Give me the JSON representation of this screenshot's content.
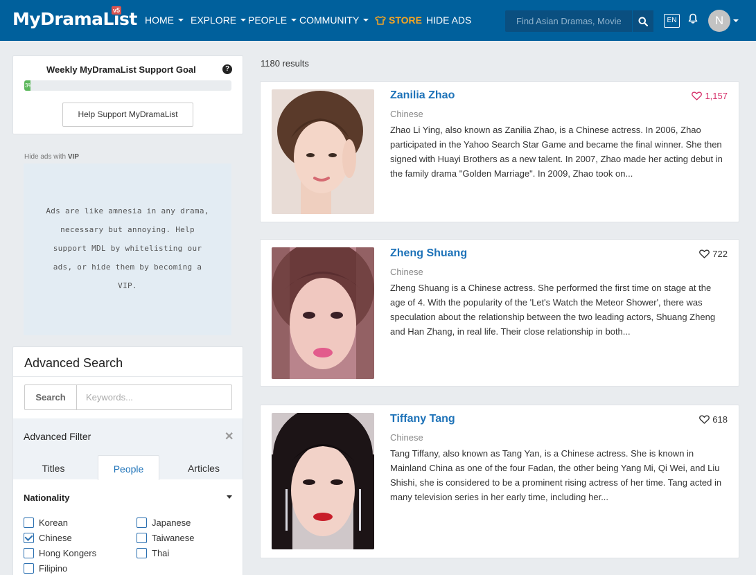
{
  "header": {
    "logo": "MyDramaList",
    "logo_badge": "v5",
    "nav": [
      {
        "label": "HOME"
      },
      {
        "label": "EXPLORE"
      },
      {
        "label": "PEOPLE"
      },
      {
        "label": "COMMUNITY"
      },
      {
        "label": "STORE"
      },
      {
        "label": "HIDE ADS"
      }
    ],
    "search_placeholder": "Find Asian Dramas, Movies",
    "lang": "EN",
    "avatar_initial": "N",
    "colors": {
      "bar": "#00609c",
      "store": "#f5a623"
    }
  },
  "support": {
    "title": "Weekly MyDramaList Support Goal",
    "progress_label": "3%",
    "progress_fraction": 0.03,
    "button": "Help Support MyDramaList"
  },
  "ads": {
    "hide_prefix": "Hide ads with",
    "hide_vip": "VIP",
    "message": "Ads are like amnesia in any drama, necessary but annoying. Help support MDL by whitelisting our ads, or hide them by becoming a VIP."
  },
  "advanced_search": {
    "title": "Advanced Search",
    "search_button": "Search",
    "keywords_placeholder": "Keywords...",
    "filter_title": "Advanced Filter",
    "tabs": [
      {
        "label": "Titles"
      },
      {
        "label": "People"
      },
      {
        "label": "Articles"
      }
    ],
    "nationality_title": "Nationality",
    "nationalities": [
      {
        "label": "Korean",
        "checked": false
      },
      {
        "label": "Japanese",
        "checked": false
      },
      {
        "label": "Chinese",
        "checked": true
      },
      {
        "label": "Taiwanese",
        "checked": false
      },
      {
        "label": "Hong Kongers",
        "checked": false
      },
      {
        "label": "Thai",
        "checked": false
      },
      {
        "label": "Filipino",
        "checked": false
      }
    ]
  },
  "results": {
    "count_text": "1180 results",
    "items": [
      {
        "name": "Zanilia Zhao",
        "likes": "1,157",
        "nationality": "Chinese",
        "bio": "Zhao Li Ying, also known as Zanilia Zhao, is a Chinese actress. In 2006, Zhao participated in the Yahoo Search Star Game and became the final winner. She then signed with Huayi Brothers as a new talent. In 2007, Zhao made her acting debut in the family drama \"Golden Marriage\". In 2009, Zhao took on..."
      },
      {
        "name": "Zheng Shuang",
        "likes": "722",
        "nationality": "Chinese",
        "bio": "Zheng Shuang is a Chinese actress. She performed the first time on stage at the age of 4. With the popularity of the 'Let's Watch the Meteor Shower', there was speculation about the relationship between the two leading actors, Shuang Zheng and Han Zhang, in real life. Their close relationship in both..."
      },
      {
        "name": "Tiffany Tang",
        "likes": "618",
        "nationality": "Chinese",
        "bio": "Tang Tiffany, also known as Tang Yan, is a Chinese actress. She is known in Mainland China as one of the four Fadan, the other being Yang Mi, Qi Wei, and Liu Shishi, she is considered to be a prominent rising actress of her time. Tang acted in many television series in her early time, including her..."
      }
    ]
  }
}
